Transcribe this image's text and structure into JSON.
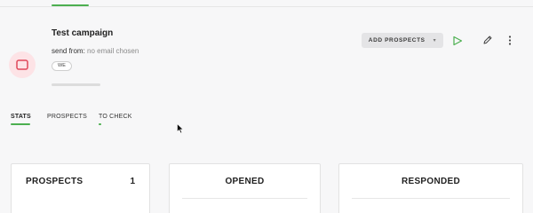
{
  "campaign": {
    "title": "Test campaign",
    "send_from_label": "send from:",
    "send_from_value": "no email chosen",
    "tag": "WE"
  },
  "toolbar": {
    "add_prospects_label": "ADD PROSPECTS",
    "add_prospects_chevron": "▾"
  },
  "tabs": [
    {
      "label": "STATS",
      "active": true
    },
    {
      "label": "PROSPECTS",
      "active": false
    },
    {
      "label": "TO CHECK",
      "active": false
    }
  ],
  "stats": {
    "prospects": {
      "title": "PROSPECTS",
      "count": "1"
    },
    "opened": {
      "title": "OPENED"
    },
    "responded": {
      "title": "RESPONDED"
    }
  },
  "colors": {
    "accent": "#4caf50",
    "icon_bg": "#fde3e6",
    "icon_fg": "#e0485a",
    "button_bg": "#e4e4e6"
  },
  "icons": {
    "campaign": "campaign-icon",
    "play": "play-icon",
    "edit": "pencil-icon",
    "more": "more-vertical-icon"
  }
}
